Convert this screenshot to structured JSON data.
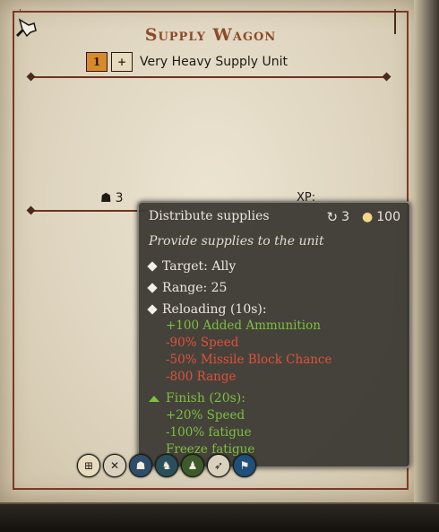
{
  "unit": {
    "title": "Supply Wagon",
    "tier_badge": "1",
    "class_badge": "+",
    "subtitle": "Very Heavy Supply Unit",
    "soldiers": "3",
    "xp_label": "XP:"
  },
  "tooltip": {
    "ability_name": "Distribute supplies",
    "cost_uses": "3",
    "cost_value": "100",
    "description": "Provide supplies to the unit",
    "target": "Target: Ally",
    "range": "Range: 25",
    "reloading": "Reloading (10s):",
    "reload_effects": [
      "+100 Added Ammunition",
      "-90% Speed",
      "-50% Missile Block Chance",
      "-800 Range"
    ],
    "finish": "Finish (20s):",
    "finish_effects": [
      "+20% Speed",
      "-100% fatigue",
      "Freeze fatigue"
    ]
  },
  "abilities": [
    {
      "icon": "supply-icon",
      "glyph": "⊞",
      "color": "#e8dcc0"
    },
    {
      "icon": "cross-icon",
      "glyph": "✕",
      "color": "#d9d1bd"
    },
    {
      "icon": "unit-icon",
      "glyph": "☗",
      "color": "#2d4d6a"
    },
    {
      "icon": "horse-icon",
      "glyph": "♞",
      "color": "#2a4f5a"
    },
    {
      "icon": "troop-icon",
      "glyph": "♟",
      "color": "#3d5a2a"
    },
    {
      "icon": "archer-icon",
      "glyph": "➶",
      "color": "#d9d1bd"
    },
    {
      "icon": "banner-icon",
      "glyph": "⚑",
      "color": "#1f4f7a"
    }
  ],
  "colors": {
    "title": "#8c4a2a",
    "positive": "#7fbf3f",
    "negative": "#e0513a"
  }
}
